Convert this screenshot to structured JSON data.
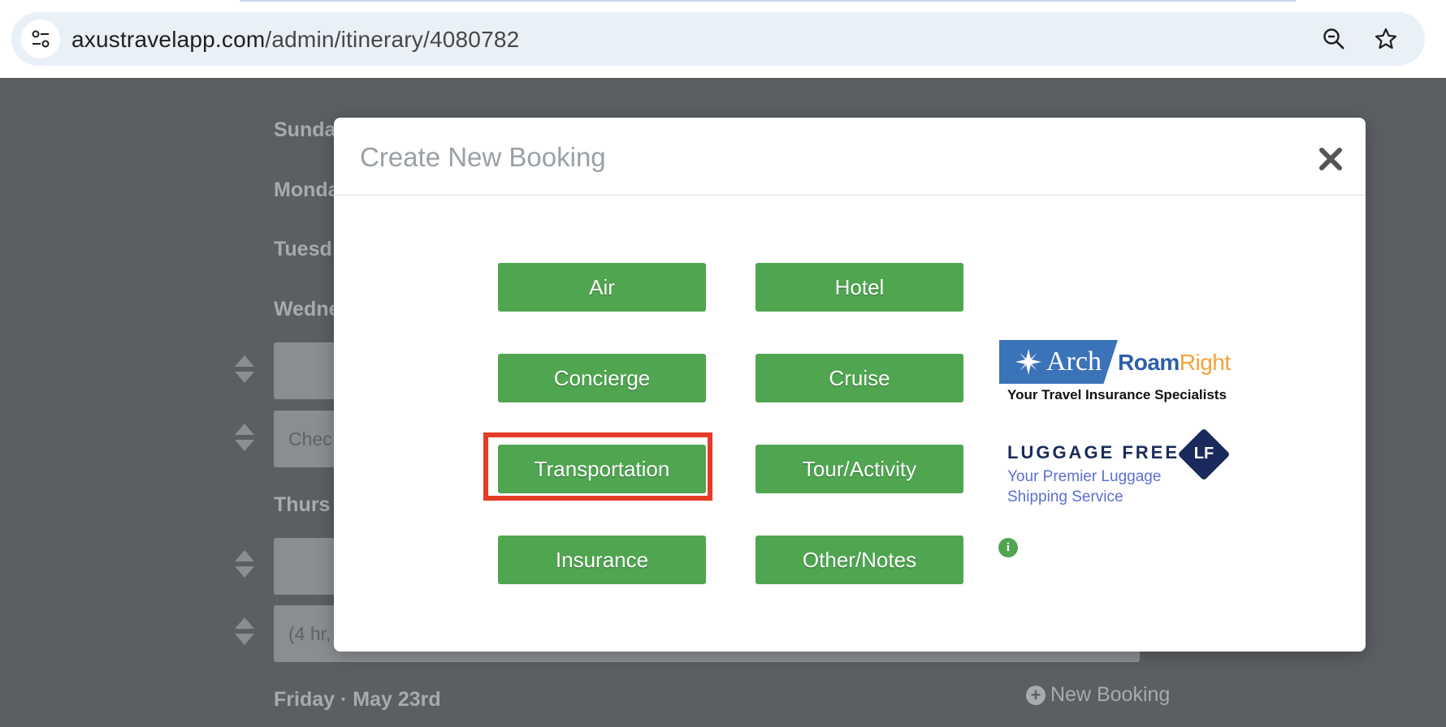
{
  "browser": {
    "url_host": "axustravelapp.com",
    "url_path": "/admin/itinerary/4080782",
    "icons": [
      "site-info-icon",
      "zoom-out-icon",
      "bookmark-star-icon"
    ]
  },
  "background": {
    "days": [
      "Sunda",
      "Monda",
      "Tuesd",
      "Wedne",
      "Thurs",
      "Friday · May 23rd"
    ],
    "card_placeholders": [
      "",
      "Chec",
      "",
      "(4 hr,"
    ],
    "new_booking_label": "New Booking"
  },
  "modal": {
    "title": "Create New Booking",
    "close_icon": "close-icon",
    "buttons": {
      "air": "Air",
      "hotel": "Hotel",
      "concierge": "Concierge",
      "cruise": "Cruise",
      "transportation": "Transportation",
      "tour_activity": "Tour/Activity",
      "insurance": "Insurance",
      "other_notes": "Other/Notes"
    },
    "highlighted": "transportation",
    "partners": {
      "arch_word": "Arch",
      "roam": "Roam",
      "right": "Right",
      "arch_tagline": "Your Travel Insurance Specialists",
      "luggage_title": "LUGGAGE FREE",
      "luggage_mark": "LF",
      "luggage_tag1": "Your Premier Luggage",
      "luggage_tag2": "Shipping Service",
      "info_icon": "info-icon",
      "info_symbol": "i"
    }
  },
  "colors": {
    "button_green": "#4fa550",
    "highlight_red": "#e53b27",
    "overlay": "#5b5e62"
  }
}
